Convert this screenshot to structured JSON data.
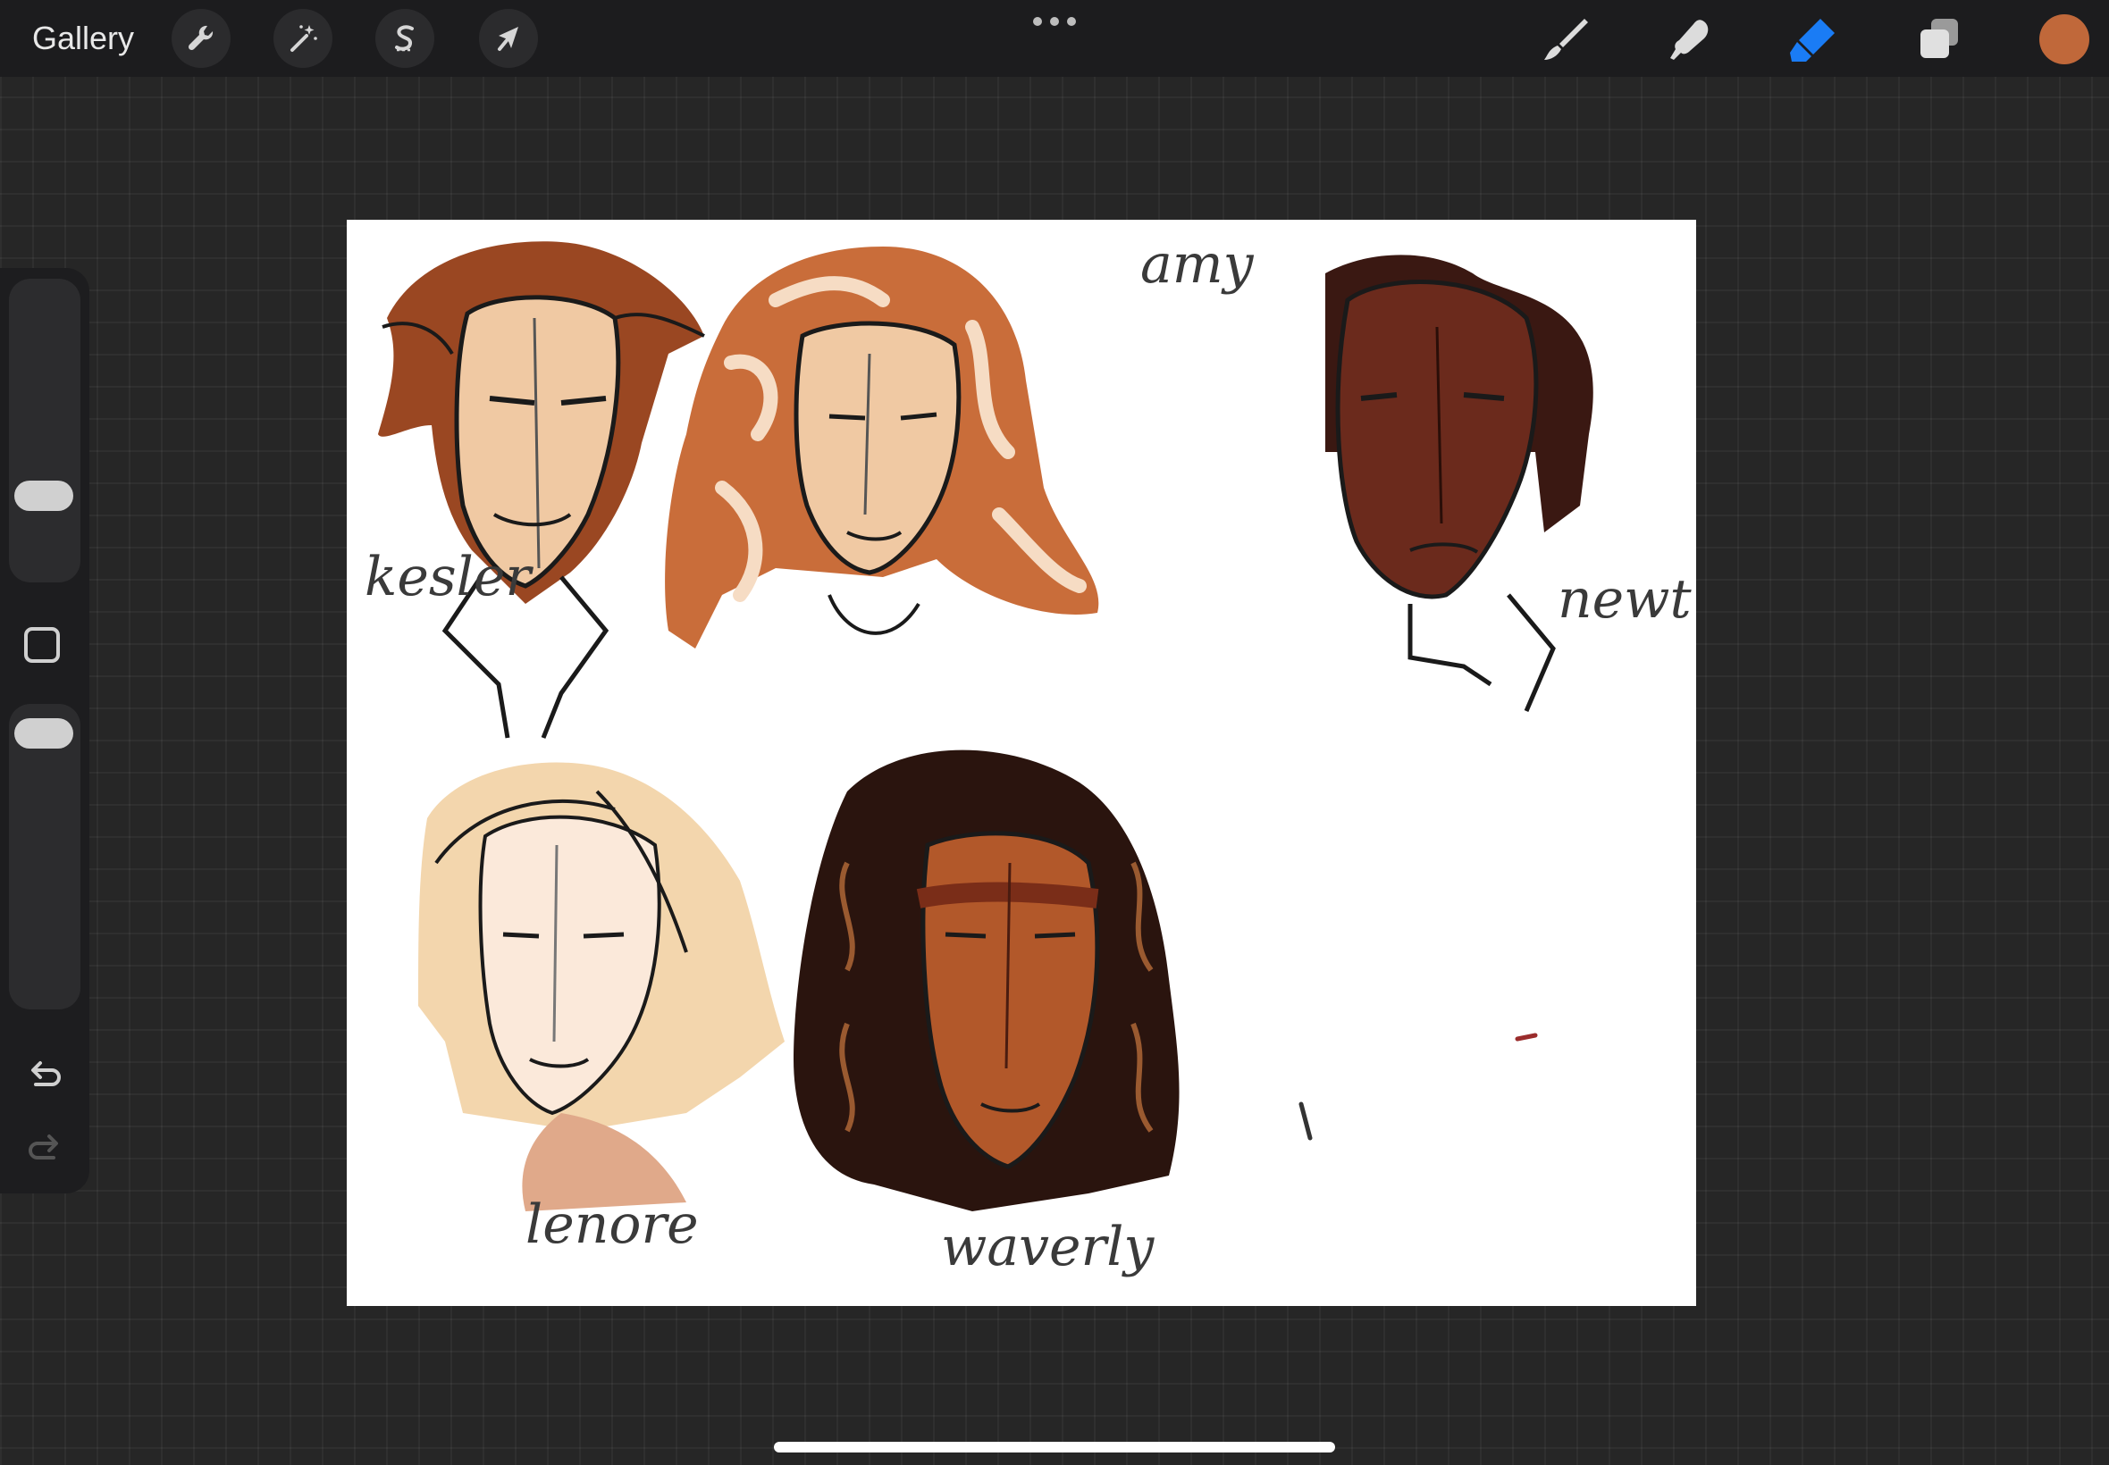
{
  "topbar": {
    "gallery_label": "Gallery",
    "left_tools": [
      {
        "name": "actions",
        "icon": "wrench-icon"
      },
      {
        "name": "adjustments",
        "icon": "magic-wand-icon"
      },
      {
        "name": "selection",
        "icon": "selection-s-icon"
      },
      {
        "name": "transform",
        "icon": "arrow-cursor-icon"
      }
    ],
    "more_icon": "ellipsis-icon",
    "right_tools": [
      {
        "name": "brush",
        "icon": "brush-icon",
        "active": false
      },
      {
        "name": "smudge",
        "icon": "smudge-finger-icon",
        "active": false
      },
      {
        "name": "eraser",
        "icon": "eraser-icon",
        "active": true
      },
      {
        "name": "layers",
        "icon": "layers-icon",
        "active": false
      }
    ],
    "current_color": "#c0683a",
    "active_tool_color": "#1a7cf5"
  },
  "sidebar": {
    "undo_icon": "undo-icon",
    "redo_icon": "redo-icon",
    "modifier_icon": "square-modifier-icon"
  },
  "canvas": {
    "background": "#ffffff",
    "labels": {
      "kesler": "kesler",
      "amy": "amy",
      "newt": "newt",
      "lenore": "lenore",
      "waverly": "waverly"
    }
  }
}
